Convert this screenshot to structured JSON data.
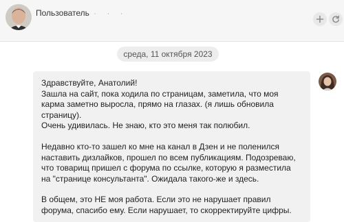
{
  "header": {
    "username": "Пользователь",
    "username_extra": "· · ·",
    "add_icon": "plus-icon",
    "refresh_icon": "refresh-icon"
  },
  "chat": {
    "date": "среда, 11 октября 2023",
    "message": {
      "paragraphs": [
        "Здравствуйте, Анатолий!\nЗашла на сайт, пока ходила по страницам, заметила, что моя карма заметно выросла, прямо на глазах. (я лишь обновила страницу).\nОчень удивилась. Не знаю, кто это меня так полюбил.",
        "Недавно кто-то зашел ко мне на канал в Дзен и не поленился наставить дизлайков, прошел по всем публикациям. Подозреваю, что товарищ пришел с форума по ссылке, которую я разместила на \"странице консультанта\". Ожидала такого-же и здесь.",
        "В общем, это НЕ моя работа. Если это не нарушает правил форума, спасибо ему. Если нарушает, то скорректируйте цифры."
      ]
    }
  },
  "colors": {
    "header_bg": "#f6f6f6",
    "bubble_bg": "#f1f1f1",
    "date_pill_bg": "#ededed"
  }
}
